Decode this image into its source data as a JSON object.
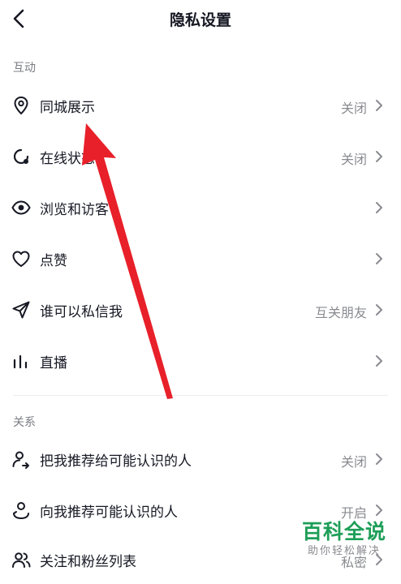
{
  "header": {
    "title": "隐私设置"
  },
  "sections": [
    {
      "label": "互动",
      "items": [
        {
          "label": "同城展示",
          "value": "关闭",
          "icon": "location-pin-icon"
        },
        {
          "label": "在线状态",
          "value": "关闭",
          "icon": "online-status-icon"
        },
        {
          "label": "浏览和访客",
          "value": "",
          "icon": "eye-icon"
        },
        {
          "label": "点赞",
          "value": "",
          "icon": "heart-icon"
        },
        {
          "label": "谁可以私信我",
          "value": "互关朋友",
          "icon": "send-icon"
        },
        {
          "label": "直播",
          "value": "",
          "icon": "live-bars-icon"
        }
      ]
    },
    {
      "label": "关系",
      "items": [
        {
          "label": "把我推荐给可能认识的人",
          "value": "关闭",
          "icon": "user-share-icon"
        },
        {
          "label": "向我推荐可能认识的人",
          "value": "开启",
          "icon": "user-recommend-icon"
        },
        {
          "label": "关注和粉丝列表",
          "value": "私密",
          "icon": "users-icon"
        }
      ]
    }
  ],
  "watermark": {
    "logo": "百科全说",
    "subtitle": "助你轻松解决"
  },
  "colors": {
    "annotation_arrow": "#e8202a",
    "watermark_green": "#1d9e57"
  }
}
